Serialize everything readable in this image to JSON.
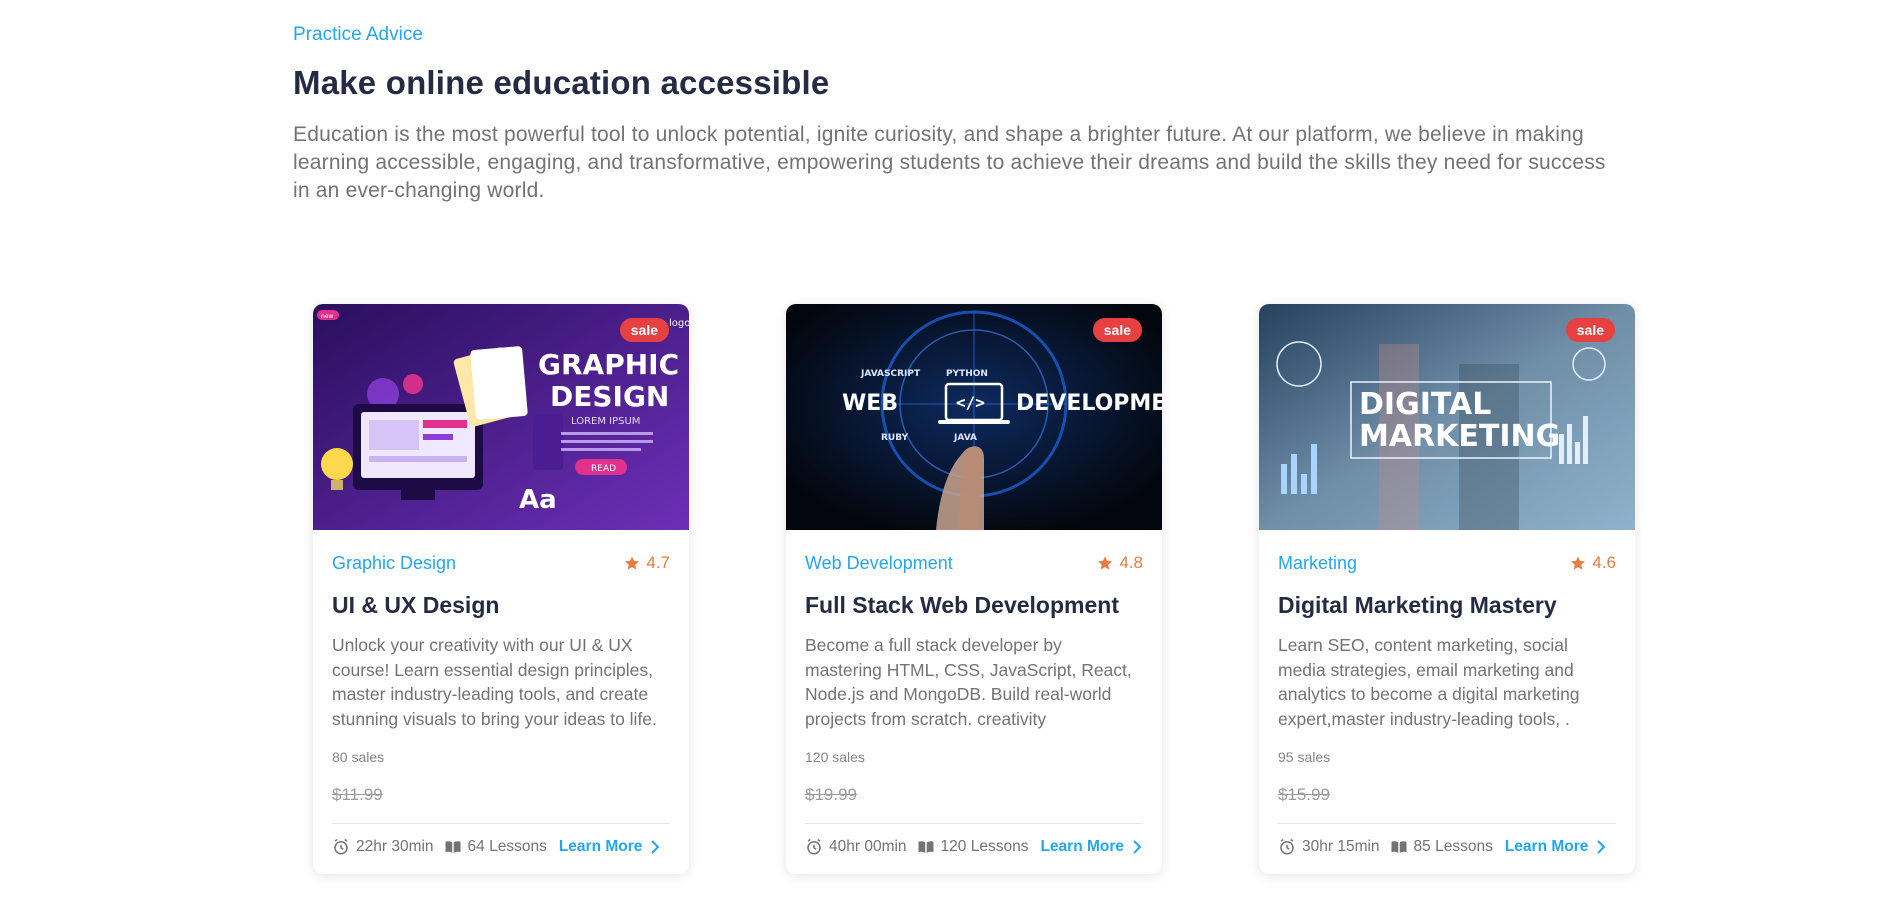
{
  "section": {
    "eyebrow": "Practice Advice",
    "heading": "Make online education accessible",
    "intro": "Education is the most powerful tool to unlock potential, ignite curiosity, and shape a brighter future. At our platform, we believe in making learning accessible, engaging, and transformative, empowering students to achieve their dreams and build the skills they need for success in an ever-changing world."
  },
  "cards": [
    {
      "badge": "sale",
      "image": {
        "line1": "GRAPHIC",
        "line2": "DESIGN",
        "line3": "LOREM IPSUM",
        "button": "READ",
        "tag": "new",
        "logo": "logo",
        "glyph": "Aa",
        "colors": [
          "#2a0f5e",
          "#6d2fb8"
        ]
      },
      "category": "Graphic Design",
      "rating": "4.7",
      "title": "UI & UX Design",
      "description": "Unlock your creativity with our UI & UX course! Learn essential design principles, master industry-leading tools, and create stunning visuals to bring your ideas to life.",
      "sales": "80 sales",
      "price": "$11.99",
      "duration": "22hr 30min",
      "lessons": "64 Lessons",
      "cta": "Learn More"
    },
    {
      "badge": "sale",
      "image": {
        "left": "WEB",
        "right": "DEVELOPMENT",
        "t1": "JAVASCRIPT",
        "t2": "PYTHON",
        "t3": "RUBY",
        "t4": "JAVA",
        "colors": [
          "#050a14",
          "#1a5fd0"
        ]
      },
      "category": "Web Development",
      "rating": "4.8",
      "title": "Full Stack Web Development",
      "description": "Become a full stack developer by mastering HTML, CSS, JavaScript, React, Node.js and MongoDB. Build real-world projects from scratch. creativity",
      "sales": "120 sales",
      "price": "$19.99",
      "duration": "40hr 00min",
      "lessons": "120 Lessons",
      "cta": "Learn More"
    },
    {
      "badge": "sale",
      "image": {
        "line1": "DIGITAL",
        "line2": "MARKETING",
        "colors": [
          "#24415e",
          "#8fb3cc"
        ]
      },
      "category": "Marketing",
      "rating": "4.6",
      "title": "Digital Marketing Mastery",
      "description": "Learn SEO, content marketing, social media strategies, email marketing and analytics to become a digital marketing expert,master industry-leading tools, .",
      "sales": "95 sales",
      "price": "$15.99",
      "duration": "30hr 15min",
      "lessons": "85 Lessons",
      "cta": "Learn More"
    }
  ],
  "icons": {
    "rating": "star-icon",
    "duration": "alarm-clock-icon",
    "lessons": "open-book-icon",
    "cta": "chevron-right-icon"
  },
  "colors": {
    "accent": "#23a6f0",
    "heading": "#252b42",
    "muted": "#737373",
    "badge": "#e74040",
    "star": "#e77c40"
  }
}
